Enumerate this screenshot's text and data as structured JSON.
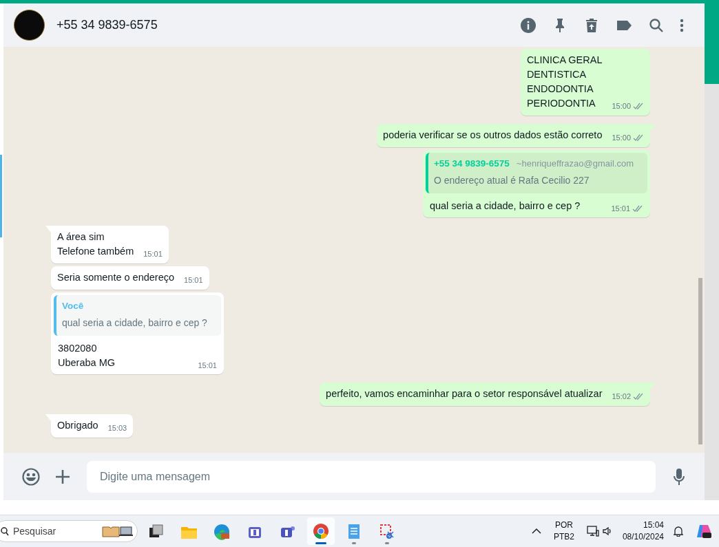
{
  "chat_header": {
    "contact": "+55 34 9839-6575"
  },
  "messages": [
    {
      "kind": "out",
      "tail": false,
      "lines": [
        "CLINICA GERAL",
        "DENTISTICA",
        "ENDODONTIA",
        "PERIODONTIA"
      ],
      "time": "15:00"
    },
    {
      "kind": "out",
      "tail": true,
      "lines": [
        "poderia verificar se os outros dados estão correto"
      ],
      "time": "15:00"
    },
    {
      "kind": "out",
      "tail": false,
      "quote": {
        "author": "+55 34 9839-6575",
        "note": "~henriqueffrazao@gmail.com",
        "text": "O endereço atual é Rafa Cecilio 227"
      },
      "lines": [
        "qual seria a cidade, bairro e cep ?"
      ],
      "time": "15:01"
    },
    {
      "kind": "in",
      "tail": true,
      "lines": [
        "A área sim",
        "Telefone também"
      ],
      "time": "15:01"
    },
    {
      "kind": "in",
      "tail": false,
      "lines": [
        "Seria somente o endereço"
      ],
      "time": "15:01"
    },
    {
      "kind": "in",
      "tail": false,
      "quote": {
        "author": "Você",
        "text": "qual seria a cidade, bairro e cep ?"
      },
      "lines": [
        "3802080",
        "Uberaba MG"
      ],
      "time": "15:01"
    },
    {
      "kind": "out",
      "tail": true,
      "lines": [
        "perfeito, vamos encaminhar para o setor responsável atualizar"
      ],
      "time": "15:02"
    },
    {
      "kind": "in",
      "tail": true,
      "lines": [
        "Obrigado"
      ],
      "time": "15:03"
    }
  ],
  "composer": {
    "placeholder": "Digite uma mensagem"
  },
  "taskbar": {
    "search": {
      "placeholder": "Pesquisar"
    },
    "apps": [
      {
        "selected": false,
        "running": false
      },
      {
        "selected": false,
        "running": false
      },
      {
        "selected": false,
        "running": false
      },
      {
        "selected": false,
        "running": false
      },
      {
        "selected": false,
        "running": false
      },
      {
        "selected": true,
        "running": true
      },
      {
        "selected": false,
        "running": true
      },
      {
        "selected": false,
        "running": true
      }
    ],
    "language": "POR",
    "layout": "PTB2",
    "time": "15:04",
    "date": "08/10/2024"
  }
}
